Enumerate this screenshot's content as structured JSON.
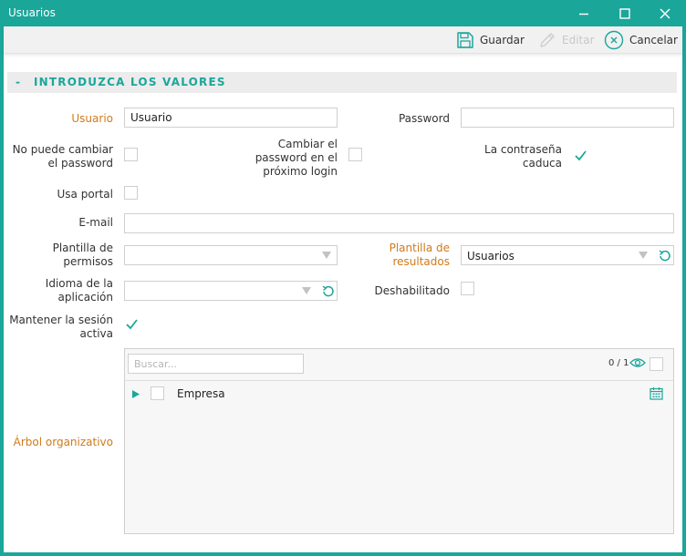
{
  "window": {
    "title": "Usuarios"
  },
  "toolbar": {
    "save_label": "Guardar",
    "edit_label": "Editar",
    "cancel_label": "Cancelar"
  },
  "section": {
    "toggle": "-",
    "title": "INTRODUZCA LOS VALORES"
  },
  "form": {
    "usuario_label": "Usuario",
    "usuario_value": "Usuario",
    "password_label": "Password",
    "password_value": "",
    "no_cambiar_label_1": "No puede cambiar",
    "no_cambiar_label_2": "el password",
    "cambiar_label_1": "Cambiar el",
    "cambiar_label_2": "password en el",
    "cambiar_label_3": "próximo login",
    "caduca_label_1": "La contraseña",
    "caduca_label_2": "caduca",
    "portal_label": "Usa portal",
    "email_label": "E-mail",
    "email_value": "",
    "plantilla_permisos_label_1": "Plantilla de",
    "plantilla_permisos_label_2": "permisos",
    "plantilla_permisos_value": "",
    "plantilla_resultados_label_1": "Plantilla de",
    "plantilla_resultados_label_2": "resultados",
    "plantilla_resultados_value": "Usuarios",
    "idioma_label_1": "Idioma de la",
    "idioma_label_2": "aplicación",
    "idioma_value": "",
    "deshabilitado_label": "Deshabilitado",
    "mantener_label_1": "Mantener la sesión",
    "mantener_label_2": "activa",
    "arbol_label": "Árbol organizativo"
  },
  "checkboxes": {
    "no_cambiar": false,
    "cambiar_proximo": false,
    "caduca": true,
    "usa_portal": false,
    "deshabilitado": false,
    "mantener_sesion": true
  },
  "tree": {
    "search_placeholder": "Buscar...",
    "counter": "0 / 1",
    "items": [
      {
        "label": "Empresa",
        "checked": false
      }
    ]
  },
  "colors": {
    "accent": "#1ba69a",
    "required_label": "#d07a1a"
  },
  "icons": [
    "minimize-icon",
    "maximize-icon",
    "close-icon",
    "save-icon",
    "edit-icon",
    "cancel-icon",
    "refresh-icon",
    "eye-icon",
    "calendar-icon",
    "expand-arrow-icon"
  ]
}
